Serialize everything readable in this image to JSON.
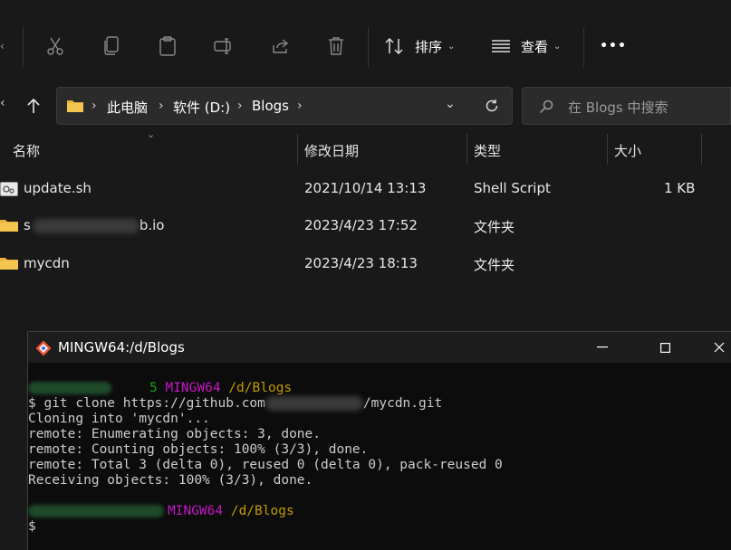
{
  "toolbar": {
    "sort_label": "排序",
    "view_label": "查看",
    "more_label": "•••"
  },
  "nav": {
    "breadcrumbs": [
      "此电脑",
      "软件 (D:)",
      "Blogs"
    ],
    "search_placeholder": "在 Blogs 中搜索"
  },
  "columns": {
    "name": "名称",
    "modified": "修改日期",
    "type": "类型",
    "size": "大小"
  },
  "files": [
    {
      "name": "update.sh",
      "modified": "2021/10/14 13:13",
      "type": "Shell Script",
      "size": "1 KB",
      "icon": "script-file-icon"
    },
    {
      "name_prefix": "s",
      "name_suffix": "b.io",
      "modified": "2023/4/23 17:52",
      "type": "文件夹",
      "size": "",
      "icon": "folder-icon"
    },
    {
      "name": "mycdn",
      "modified": "2023/4/23 18:13",
      "type": "文件夹",
      "size": "",
      "icon": "folder-icon"
    }
  ],
  "terminal": {
    "title": "MINGW64:/d/Blogs",
    "prompt1_tail": "5",
    "prompt_host": "MINGW64",
    "prompt_path": "/d/Blogs",
    "cmd_prefix": "$ git clone https://github.com",
    "cmd_suffix": "/mycdn.git",
    "lines": [
      "Cloning into 'mycdn'...",
      "remote: Enumerating objects: 3, done.",
      "remote: Counting objects: 100% (3/3), done.",
      "remote: Total 3 (delta 0), reused 0 (delta 0), pack-reused 0",
      "Receiving objects: 100% (3/3), done."
    ],
    "final_prompt": "$",
    "colors": {
      "green": "#13a10e",
      "magenta": "#c418c4",
      "yellow": "#c19c00"
    }
  }
}
